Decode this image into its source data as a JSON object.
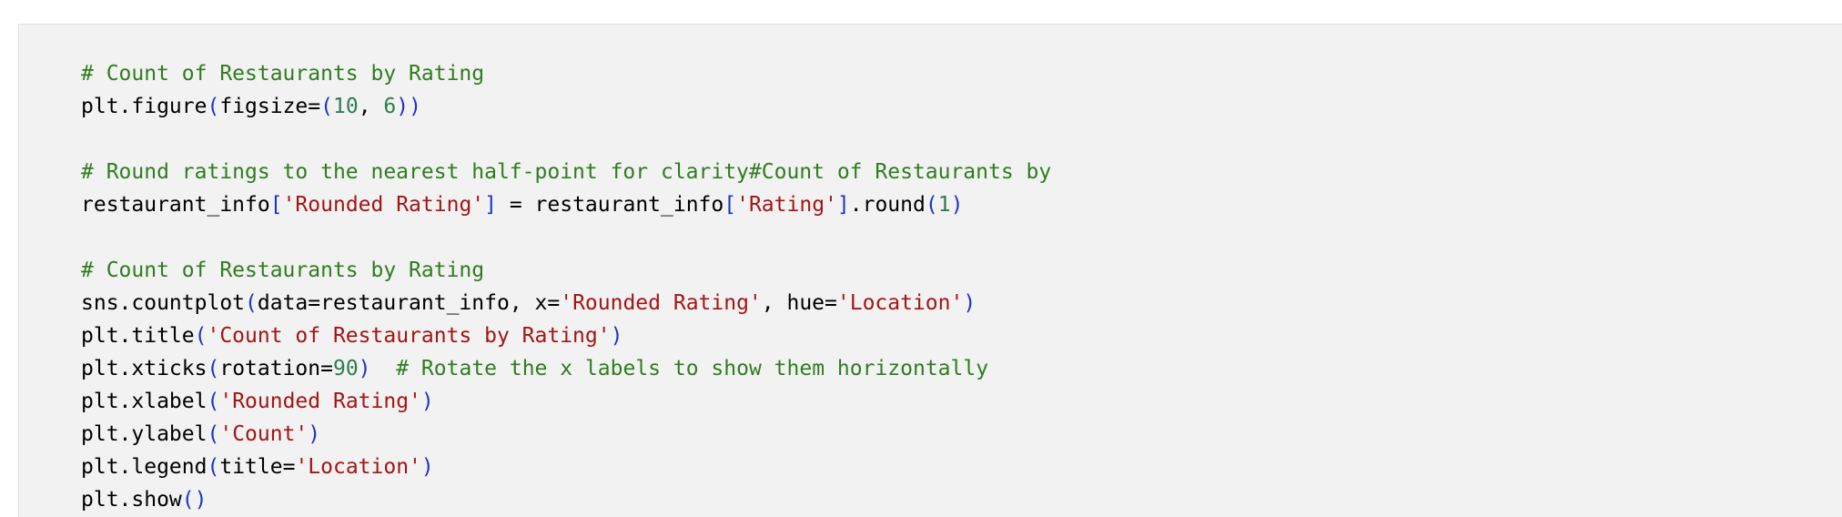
{
  "code_cell": {
    "lines": [
      [
        {
          "t": "cm",
          "v": "# Count of Restaurants by Rating"
        }
      ],
      [
        {
          "t": "tx",
          "v": "plt.figure"
        },
        {
          "t": "br",
          "v": "("
        },
        {
          "t": "tx",
          "v": "figsize="
        },
        {
          "t": "br",
          "v": "("
        },
        {
          "t": "nu",
          "v": "10"
        },
        {
          "t": "tx",
          "v": ", "
        },
        {
          "t": "nu",
          "v": "6"
        },
        {
          "t": "br",
          "v": "))"
        }
      ],
      [],
      [
        {
          "t": "cm",
          "v": "# Round ratings to the nearest half-point for clarity#Count of Restaurants by"
        }
      ],
      [
        {
          "t": "tx",
          "v": "restaurant_info"
        },
        {
          "t": "br",
          "v": "["
        },
        {
          "t": "st",
          "v": "'Rounded Rating'"
        },
        {
          "t": "br",
          "v": "]"
        },
        {
          "t": "tx",
          "v": " = restaurant_info"
        },
        {
          "t": "br",
          "v": "["
        },
        {
          "t": "st",
          "v": "'Rating'"
        },
        {
          "t": "br",
          "v": "]"
        },
        {
          "t": "tx",
          "v": ".round"
        },
        {
          "t": "br",
          "v": "("
        },
        {
          "t": "nu",
          "v": "1"
        },
        {
          "t": "br",
          "v": ")"
        }
      ],
      [],
      [
        {
          "t": "cm",
          "v": "# Count of Restaurants by Rating"
        }
      ],
      [
        {
          "t": "tx",
          "v": "sns.countplot"
        },
        {
          "t": "br",
          "v": "("
        },
        {
          "t": "tx",
          "v": "data=restaurant_info, x="
        },
        {
          "t": "st",
          "v": "'Rounded Rating'"
        },
        {
          "t": "tx",
          "v": ", hue="
        },
        {
          "t": "st",
          "v": "'Location'"
        },
        {
          "t": "br",
          "v": ")"
        }
      ],
      [
        {
          "t": "tx",
          "v": "plt.title"
        },
        {
          "t": "br",
          "v": "("
        },
        {
          "t": "st",
          "v": "'Count of Restaurants by Rating'"
        },
        {
          "t": "br",
          "v": ")"
        }
      ],
      [
        {
          "t": "tx",
          "v": "plt.xticks"
        },
        {
          "t": "br",
          "v": "("
        },
        {
          "t": "tx",
          "v": "rotation="
        },
        {
          "t": "nu",
          "v": "90"
        },
        {
          "t": "br",
          "v": ")"
        },
        {
          "t": "tx",
          "v": "  "
        },
        {
          "t": "cm",
          "v": "# Rotate the x labels to show them horizontally"
        }
      ],
      [
        {
          "t": "tx",
          "v": "plt.xlabel"
        },
        {
          "t": "br",
          "v": "("
        },
        {
          "t": "st",
          "v": "'Rounded Rating'"
        },
        {
          "t": "br",
          "v": ")"
        }
      ],
      [
        {
          "t": "tx",
          "v": "plt.ylabel"
        },
        {
          "t": "br",
          "v": "("
        },
        {
          "t": "st",
          "v": "'Count'"
        },
        {
          "t": "br",
          "v": ")"
        }
      ],
      [
        {
          "t": "tx",
          "v": "plt.legend"
        },
        {
          "t": "br",
          "v": "("
        },
        {
          "t": "tx",
          "v": "title="
        },
        {
          "t": "st",
          "v": "'Location'"
        },
        {
          "t": "br",
          "v": ")"
        }
      ],
      [
        {
          "t": "tx",
          "v": "plt.show"
        },
        {
          "t": "br",
          "v": "()"
        }
      ]
    ]
  },
  "colors": {
    "background": "#ffffff",
    "cell_background": "#f2f2f2",
    "comment": "#2f7d1f",
    "string": "#a31515",
    "number": "#2e7d4f",
    "bracket": "#1c33c9",
    "text": "#000000"
  }
}
